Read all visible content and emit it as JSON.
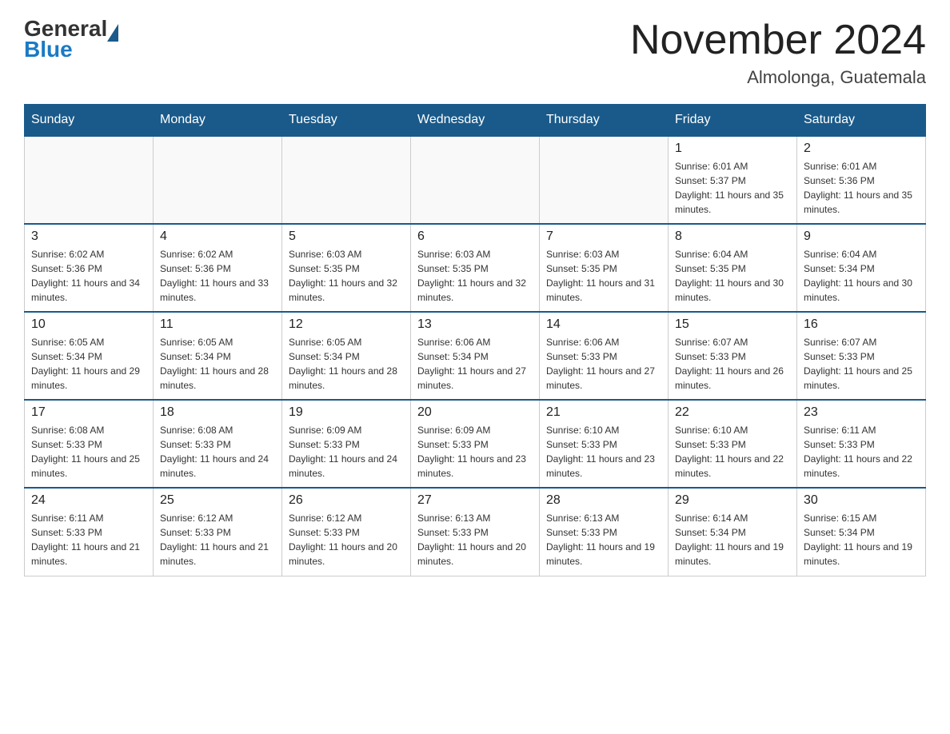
{
  "header": {
    "logo_general": "General",
    "logo_blue": "Blue",
    "month_title": "November 2024",
    "location": "Almolonga, Guatemala"
  },
  "days_of_week": [
    "Sunday",
    "Monday",
    "Tuesday",
    "Wednesday",
    "Thursday",
    "Friday",
    "Saturday"
  ],
  "weeks": [
    [
      {
        "day": "",
        "info": ""
      },
      {
        "day": "",
        "info": ""
      },
      {
        "day": "",
        "info": ""
      },
      {
        "day": "",
        "info": ""
      },
      {
        "day": "",
        "info": ""
      },
      {
        "day": "1",
        "info": "Sunrise: 6:01 AM\nSunset: 5:37 PM\nDaylight: 11 hours and 35 minutes."
      },
      {
        "day": "2",
        "info": "Sunrise: 6:01 AM\nSunset: 5:36 PM\nDaylight: 11 hours and 35 minutes."
      }
    ],
    [
      {
        "day": "3",
        "info": "Sunrise: 6:02 AM\nSunset: 5:36 PM\nDaylight: 11 hours and 34 minutes."
      },
      {
        "day": "4",
        "info": "Sunrise: 6:02 AM\nSunset: 5:36 PM\nDaylight: 11 hours and 33 minutes."
      },
      {
        "day": "5",
        "info": "Sunrise: 6:03 AM\nSunset: 5:35 PM\nDaylight: 11 hours and 32 minutes."
      },
      {
        "day": "6",
        "info": "Sunrise: 6:03 AM\nSunset: 5:35 PM\nDaylight: 11 hours and 32 minutes."
      },
      {
        "day": "7",
        "info": "Sunrise: 6:03 AM\nSunset: 5:35 PM\nDaylight: 11 hours and 31 minutes."
      },
      {
        "day": "8",
        "info": "Sunrise: 6:04 AM\nSunset: 5:35 PM\nDaylight: 11 hours and 30 minutes."
      },
      {
        "day": "9",
        "info": "Sunrise: 6:04 AM\nSunset: 5:34 PM\nDaylight: 11 hours and 30 minutes."
      }
    ],
    [
      {
        "day": "10",
        "info": "Sunrise: 6:05 AM\nSunset: 5:34 PM\nDaylight: 11 hours and 29 minutes."
      },
      {
        "day": "11",
        "info": "Sunrise: 6:05 AM\nSunset: 5:34 PM\nDaylight: 11 hours and 28 minutes."
      },
      {
        "day": "12",
        "info": "Sunrise: 6:05 AM\nSunset: 5:34 PM\nDaylight: 11 hours and 28 minutes."
      },
      {
        "day": "13",
        "info": "Sunrise: 6:06 AM\nSunset: 5:34 PM\nDaylight: 11 hours and 27 minutes."
      },
      {
        "day": "14",
        "info": "Sunrise: 6:06 AM\nSunset: 5:33 PM\nDaylight: 11 hours and 27 minutes."
      },
      {
        "day": "15",
        "info": "Sunrise: 6:07 AM\nSunset: 5:33 PM\nDaylight: 11 hours and 26 minutes."
      },
      {
        "day": "16",
        "info": "Sunrise: 6:07 AM\nSunset: 5:33 PM\nDaylight: 11 hours and 25 minutes."
      }
    ],
    [
      {
        "day": "17",
        "info": "Sunrise: 6:08 AM\nSunset: 5:33 PM\nDaylight: 11 hours and 25 minutes."
      },
      {
        "day": "18",
        "info": "Sunrise: 6:08 AM\nSunset: 5:33 PM\nDaylight: 11 hours and 24 minutes."
      },
      {
        "day": "19",
        "info": "Sunrise: 6:09 AM\nSunset: 5:33 PM\nDaylight: 11 hours and 24 minutes."
      },
      {
        "day": "20",
        "info": "Sunrise: 6:09 AM\nSunset: 5:33 PM\nDaylight: 11 hours and 23 minutes."
      },
      {
        "day": "21",
        "info": "Sunrise: 6:10 AM\nSunset: 5:33 PM\nDaylight: 11 hours and 23 minutes."
      },
      {
        "day": "22",
        "info": "Sunrise: 6:10 AM\nSunset: 5:33 PM\nDaylight: 11 hours and 22 minutes."
      },
      {
        "day": "23",
        "info": "Sunrise: 6:11 AM\nSunset: 5:33 PM\nDaylight: 11 hours and 22 minutes."
      }
    ],
    [
      {
        "day": "24",
        "info": "Sunrise: 6:11 AM\nSunset: 5:33 PM\nDaylight: 11 hours and 21 minutes."
      },
      {
        "day": "25",
        "info": "Sunrise: 6:12 AM\nSunset: 5:33 PM\nDaylight: 11 hours and 21 minutes."
      },
      {
        "day": "26",
        "info": "Sunrise: 6:12 AM\nSunset: 5:33 PM\nDaylight: 11 hours and 20 minutes."
      },
      {
        "day": "27",
        "info": "Sunrise: 6:13 AM\nSunset: 5:33 PM\nDaylight: 11 hours and 20 minutes."
      },
      {
        "day": "28",
        "info": "Sunrise: 6:13 AM\nSunset: 5:33 PM\nDaylight: 11 hours and 19 minutes."
      },
      {
        "day": "29",
        "info": "Sunrise: 6:14 AM\nSunset: 5:34 PM\nDaylight: 11 hours and 19 minutes."
      },
      {
        "day": "30",
        "info": "Sunrise: 6:15 AM\nSunset: 5:34 PM\nDaylight: 11 hours and 19 minutes."
      }
    ]
  ]
}
